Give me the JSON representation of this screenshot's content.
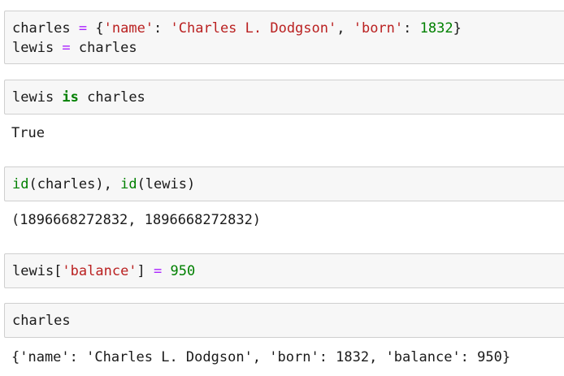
{
  "cells": [
    {
      "lines": [
        [
          {
            "t": "charles ",
            "c": "plain"
          },
          {
            "t": "=",
            "c": "op"
          },
          {
            "t": " {",
            "c": "plain"
          },
          {
            "t": "'name'",
            "c": "str"
          },
          {
            "t": ": ",
            "c": "plain"
          },
          {
            "t": "'Charles L. Dodgson'",
            "c": "str"
          },
          {
            "t": ", ",
            "c": "plain"
          },
          {
            "t": "'born'",
            "c": "str"
          },
          {
            "t": ": ",
            "c": "plain"
          },
          {
            "t": "1832",
            "c": "num"
          },
          {
            "t": "}",
            "c": "plain"
          }
        ],
        [
          {
            "t": "lewis ",
            "c": "plain"
          },
          {
            "t": "=",
            "c": "op"
          },
          {
            "t": " charles",
            "c": "plain"
          }
        ]
      ],
      "output": ""
    },
    {
      "lines": [
        [
          {
            "t": "lewis ",
            "c": "plain"
          },
          {
            "t": "is",
            "c": "kw"
          },
          {
            "t": " charles",
            "c": "plain"
          }
        ]
      ],
      "output": "True"
    },
    {
      "lines": [
        [
          {
            "t": "id",
            "c": "builtin"
          },
          {
            "t": "(charles), ",
            "c": "plain"
          },
          {
            "t": "id",
            "c": "builtin"
          },
          {
            "t": "(lewis)",
            "c": "plain"
          }
        ]
      ],
      "output": "(1896668272832, 1896668272832)"
    },
    {
      "lines": [
        [
          {
            "t": "lewis[",
            "c": "plain"
          },
          {
            "t": "'balance'",
            "c": "str"
          },
          {
            "t": "] ",
            "c": "plain"
          },
          {
            "t": "=",
            "c": "op"
          },
          {
            "t": " ",
            "c": "plain"
          },
          {
            "t": "950",
            "c": "num"
          }
        ]
      ],
      "output": ""
    },
    {
      "lines": [
        [
          {
            "t": "charles",
            "c": "plain"
          }
        ]
      ],
      "output": "{'name': 'Charles L. Dodgson', 'born': 1832, 'balance': 950}"
    }
  ]
}
